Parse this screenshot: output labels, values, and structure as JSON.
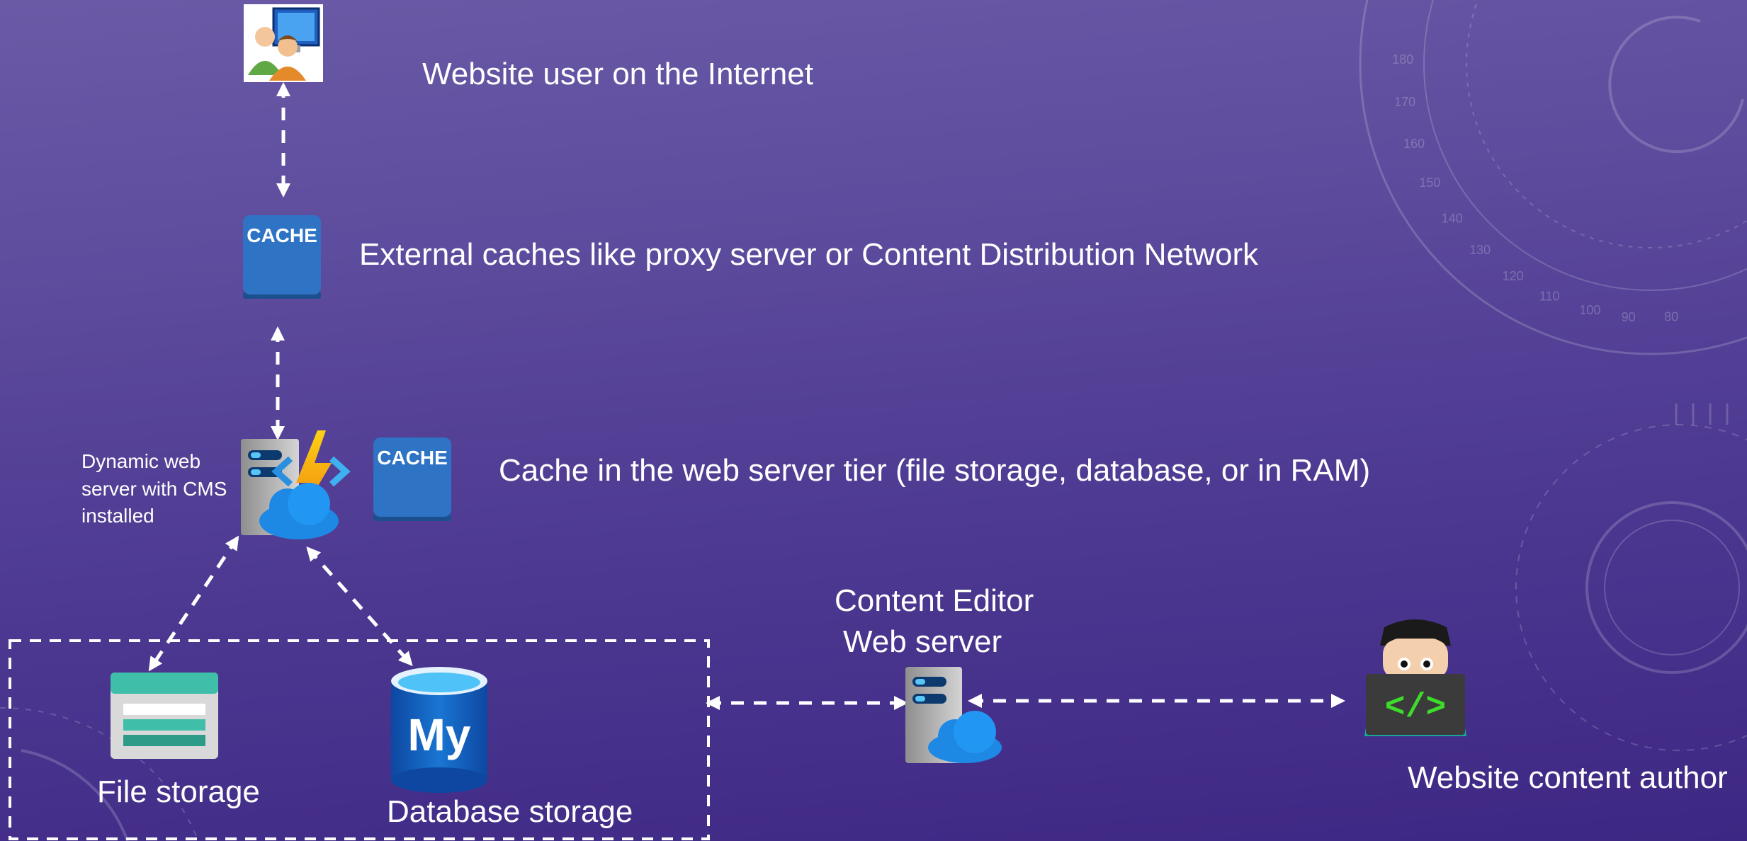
{
  "labels": {
    "website_user": "Website user on the Internet",
    "external_caches": "External caches like proxy server or Content Distribution Network",
    "server_tier_cache": "Cache in the web server tier (file storage, database, or in RAM)",
    "dynamic_server": "Dynamic web server with CMS installed",
    "content_editor_line1": "Content Editor",
    "content_editor_line2": "Web server",
    "file_storage": "File storage",
    "database_storage": "Database storage",
    "content_author": "Website content author"
  },
  "badges": {
    "cache_top": "CACHE",
    "cache_server": "CACHE",
    "mysql": "My"
  },
  "decor": {
    "dial_ticks": [
      "180",
      "170",
      "160",
      "150",
      "140",
      "130",
      "120",
      "110",
      "100",
      "90",
      "80"
    ]
  },
  "colors": {
    "background_top": "#6a5aa6",
    "background_bottom": "#3d2784",
    "cache_blue": "#2e73c4",
    "cloud_blue": "#1e88e5",
    "bolt_orange": "#f5a623",
    "storage_teal": "#3fbfa9",
    "mysql_blue": "#1565c0",
    "code_green": "#3ddc2a"
  }
}
